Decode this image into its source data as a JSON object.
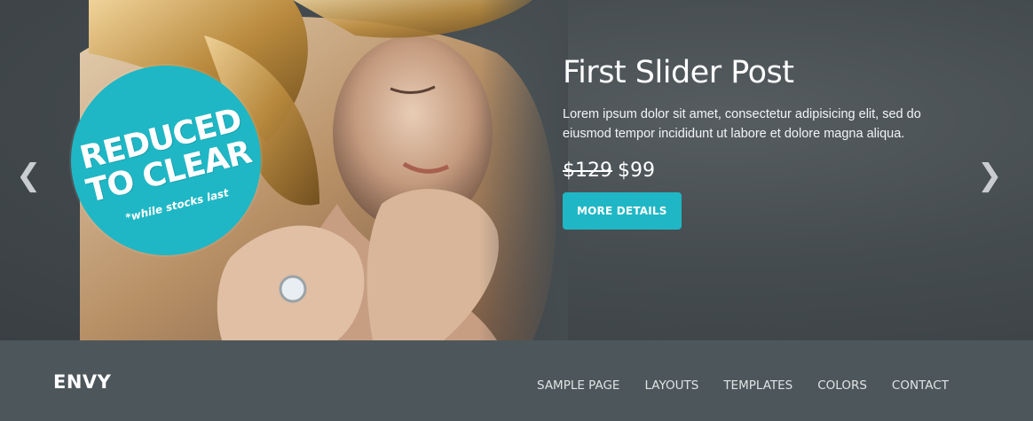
{
  "slider": {
    "prev_arrow": "❮",
    "next_arrow": "❯",
    "badge": {
      "line1": "REDUCED",
      "line2": "TO CLEAR",
      "note": "*while stocks last",
      "color": "#1fb7c5"
    },
    "slide": {
      "title": "First Slider Post",
      "description": "Lorem ipsum dolor sit amet, consectetur adipisicing elit, sed do eiusmod tempor incididunt ut labore et dolore magna aliqua.",
      "price_old": "$129",
      "price_new": "$99",
      "button_label": "MORE DETAILS",
      "button_color": "#1fb7c5"
    }
  },
  "navbar": {
    "logo": "ENVY",
    "menu": [
      "SAMPLE PAGE",
      "LAYOUTS",
      "TEMPLATES",
      "COLORS",
      "CONTACT"
    ],
    "background": "#4d575b"
  }
}
